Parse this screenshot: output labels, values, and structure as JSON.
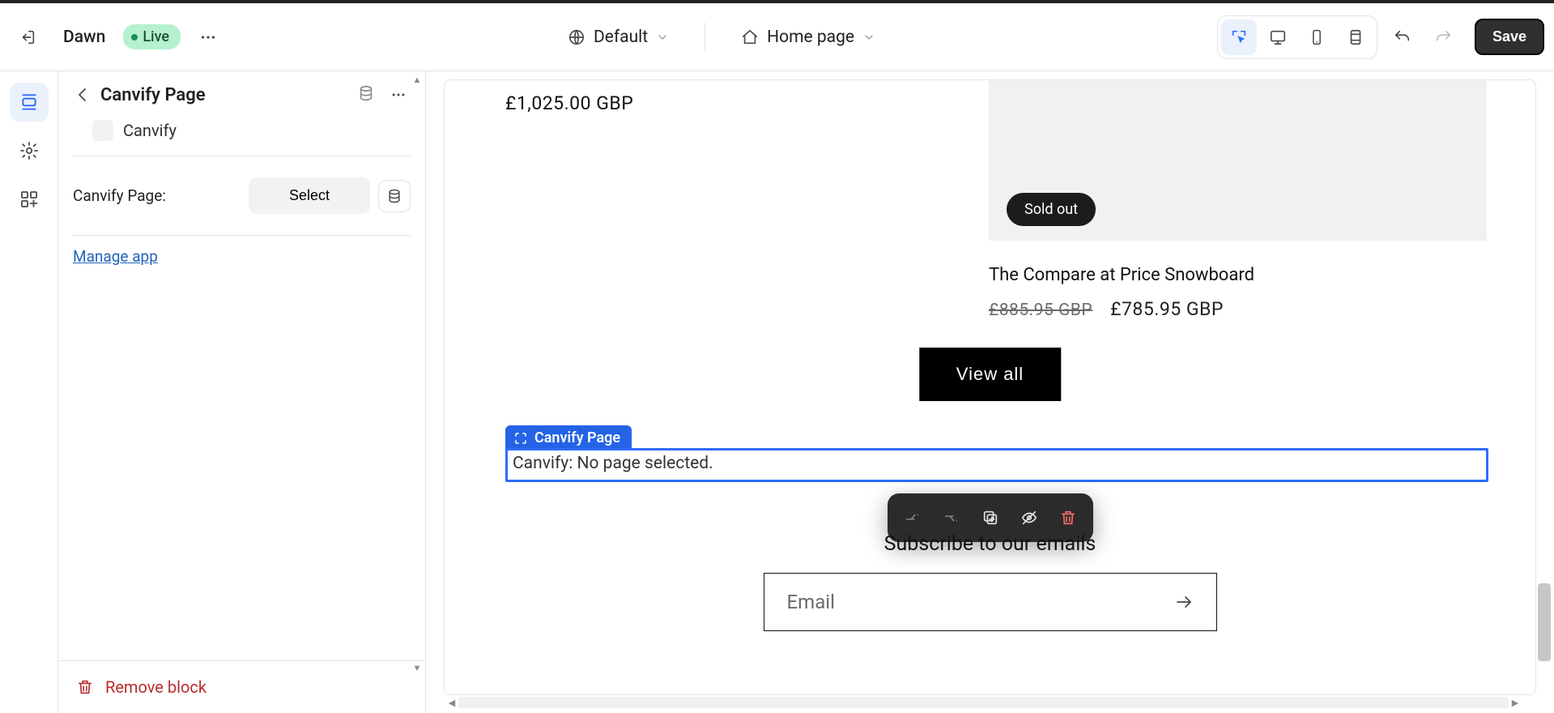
{
  "topbar": {
    "theme_name": "Dawn",
    "live_badge": "Live",
    "locale_label": "Default",
    "page_label": "Home page",
    "save_label": "Save"
  },
  "sidebar": {
    "section_title": "Canvify Page",
    "block_label": "Canvify",
    "page_setting_label": "Canvify Page:",
    "select_button": "Select",
    "manage_link": "Manage app",
    "remove_block": "Remove block"
  },
  "preview": {
    "left_price": "£1,025.00 GBP",
    "soldout": "Sold out",
    "product_title": "The Compare at Price Snowboard",
    "old_price": "£885.95 GBP",
    "new_price": "£785.95 GBP",
    "view_all": "View all",
    "section_tag": "Canvify Page",
    "section_placeholder": "Canvify: No page selected.",
    "subscribe_heading": "Subscribe to our emails",
    "email_placeholder": "Email"
  },
  "colors": {
    "accent": "#2e6cff",
    "live_badge_bg": "#b5f0cf",
    "danger": "#b92c2c"
  }
}
